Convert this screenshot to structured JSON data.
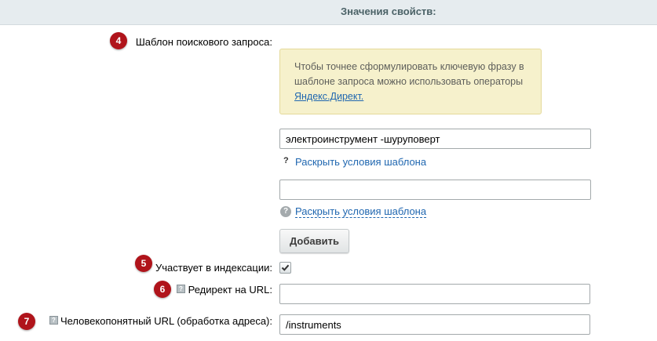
{
  "header": {
    "title": "Значения свойств:"
  },
  "markers": [
    "4",
    "5",
    "6",
    "7"
  ],
  "query_template": {
    "label": "Шаблон поискового запроса:",
    "hint": {
      "text": "Чтобы точнее сформулировать ключевую фразу в шаблоне запроса можно использовать операторы",
      "link": "Яндекс.Директ."
    },
    "inputs": [
      {
        "value": "электроинструмент -шуруповерт",
        "help_link": "Раскрыть условия шаблона"
      },
      {
        "value": "",
        "help_link": "Раскрыть условия шаблона"
      }
    ],
    "add_button": "Добавить"
  },
  "indexing": {
    "label": "Участвует в индексации:",
    "checked": true
  },
  "redirect": {
    "label": "Редирект на URL:",
    "value": ""
  },
  "human_url": {
    "label": "Человекопонятный URL (обработка адреса):",
    "value": "/instruments"
  }
}
